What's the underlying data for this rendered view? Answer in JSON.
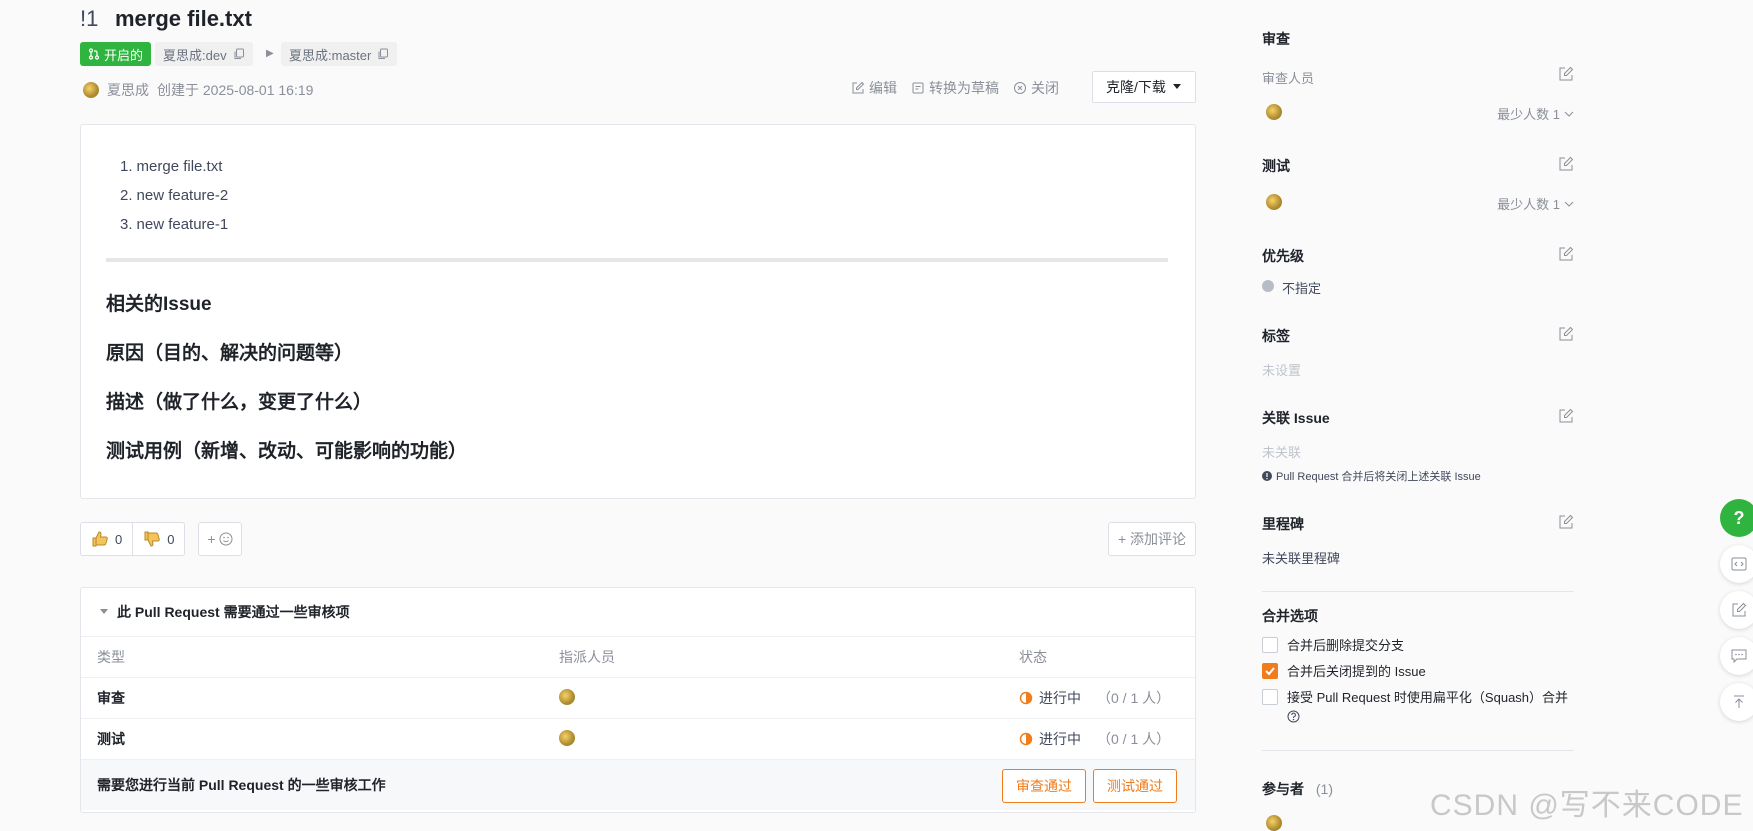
{
  "pr": {
    "number": "!1",
    "title": "merge file.txt",
    "status": "开启的",
    "source_branch": "夏思成:dev",
    "target_branch": "夏思成:master",
    "author": "夏思成",
    "created": "创建于 2025-08-01 16:19"
  },
  "toolbar": {
    "edit": "编辑",
    "draft": "转换为草稿",
    "close": "关闭",
    "clone": "克隆/下载"
  },
  "description": {
    "list": [
      {
        "num": "1.",
        "text": "merge file.txt"
      },
      {
        "num": "2.",
        "text": "new feature-2"
      },
      {
        "num": "3.",
        "text": "new feature-1"
      }
    ],
    "h_issue": "相关的Issue",
    "h_reason": "原因（目的、解决的问题等）",
    "h_desc": "描述（做了什么，变更了什么）",
    "h_test": "测试用例（新增、改动、可能影响的功能）"
  },
  "reactions": {
    "up_count": "0",
    "down_count": "0",
    "emoji_add": "+",
    "add_comment": "+ 添加评论"
  },
  "review": {
    "heading": "此 Pull Request 需要通过一些审核项",
    "col_type": "类型",
    "col_assignee": "指派人员",
    "col_status": "状态",
    "rows": [
      {
        "type": "审查",
        "status": "进行中",
        "count": "（0 / 1 人）"
      },
      {
        "type": "测试",
        "status": "进行中",
        "count": "（0 / 1 人）"
      }
    ],
    "footer_msg": "需要您进行当前 Pull Request 的一些审核工作",
    "btn_review": "审查通过",
    "btn_test": "测试通过"
  },
  "sidebar": {
    "review_title": "审查",
    "reviewers_label": "审查人员",
    "min_people": "最少人数 1",
    "test_title": "测试",
    "priority_title": "优先级",
    "priority_value": "不指定",
    "labels_title": "标签",
    "labels_value": "未设置",
    "issue_title": "关联 Issue",
    "issue_value": "未关联",
    "issue_note": "Pull Request 合并后将关闭上述关联 Issue",
    "milestone_title": "里程碑",
    "milestone_value": "未关联里程碑",
    "merge_title": "合并选项",
    "opt_delete_branch": "合并后删除提交分支",
    "opt_close_issue": "合并后关闭提到的 Issue",
    "opt_squash": "接受 Pull Request 时使用扁平化（Squash）合并",
    "participants_title": "参与者",
    "participants_count": "(1)"
  },
  "fab": {
    "help": "?"
  },
  "watermark": "CSDN @写不来CODE",
  "colors": {
    "accent_green": "#2fb53f",
    "accent_orange": "#f07c1b"
  }
}
